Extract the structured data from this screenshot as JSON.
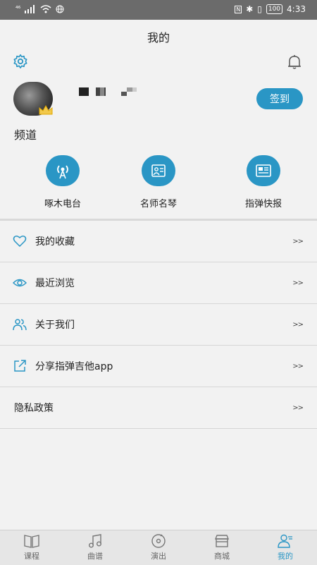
{
  "status_bar": {
    "signal": "⁴⁶",
    "time": "4:33",
    "battery": "100"
  },
  "header": {
    "title": "我的"
  },
  "profile": {
    "signin_label": "签到"
  },
  "channels": {
    "section_title": "频道",
    "items": [
      {
        "label": "啄木电台",
        "icon": "radio-icon"
      },
      {
        "label": "名师名琴",
        "icon": "teacher-icon"
      },
      {
        "label": "指弹快报",
        "icon": "news-icon"
      }
    ]
  },
  "menu": {
    "items": [
      {
        "label": "我的收藏",
        "icon": "heart-icon",
        "arrow": ">>"
      },
      {
        "label": "最近浏览",
        "icon": "eye-icon",
        "arrow": ">>"
      },
      {
        "label": "关于我们",
        "icon": "people-icon",
        "arrow": ">>"
      },
      {
        "label": "分享指弹吉他app",
        "icon": "share-icon",
        "arrow": ">>"
      },
      {
        "label": "隐私政策",
        "icon": "",
        "arrow": ">>"
      }
    ]
  },
  "tabbar": {
    "tabs": [
      {
        "label": "课程",
        "icon": "book-icon",
        "active": false
      },
      {
        "label": "曲谱",
        "icon": "music-note-icon",
        "active": false
      },
      {
        "label": "演出",
        "icon": "disc-icon",
        "active": false
      },
      {
        "label": "商城",
        "icon": "store-icon",
        "active": false
      },
      {
        "label": "我的",
        "icon": "user-icon",
        "active": true
      }
    ]
  },
  "colors": {
    "accent": "#2a96c5",
    "background": "#f2f2f2"
  }
}
